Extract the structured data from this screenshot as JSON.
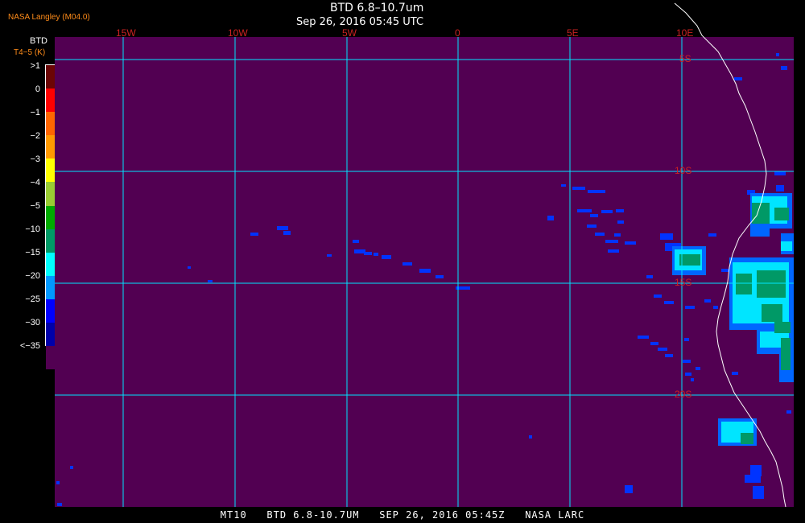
{
  "header": {
    "title": "BTD 6.8–10.7um",
    "datetime": "Sep 26, 2016 05:45 UTC",
    "provider": "NASA Langley (M04.0)"
  },
  "legend": {
    "title": "BTD",
    "units": "T4−5 (K)",
    "labels": [
      ">1",
      "0",
      "−1",
      "−2",
      "−3",
      "−4",
      "−5",
      "−10",
      "−15",
      "−20",
      "−25",
      "−30",
      "<−35"
    ],
    "colors": [
      "#6b0505",
      "#ff0000",
      "#ff6600",
      "#ff9900",
      "#ffff00",
      "#99cc33",
      "#00aa00",
      "#009966",
      "#00ffff",
      "#0099ff",
      "#0000ff",
      "#0000aa",
      "#520052"
    ]
  },
  "map": {
    "background_color": "#520052",
    "grid_color": "#00e5ff",
    "label_color": "#cc2222",
    "longitude_labels": [
      "15W",
      "10W",
      "5W",
      "0",
      "5E",
      "10E"
    ],
    "latitude_labels": [
      "5S",
      "10S",
      "15S",
      "20S"
    ]
  },
  "footer": {
    "product": "MT10",
    "channel": "BTD 6.8-10.7UM",
    "date": "SEP 26, 2016 05:45Z",
    "source": "NASA LARC"
  }
}
